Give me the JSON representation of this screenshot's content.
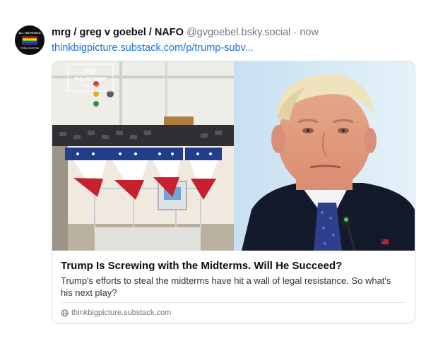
{
  "post": {
    "author": {
      "display_name": "mrg / greg v goebel / NAFO",
      "handle": "@gvgoebel.bsky.social",
      "avatar_text_top": "ALL THE PEOPLE",
      "avatar_text_bottom": "PRIDE EVERYONE"
    },
    "separator": "·",
    "time": "now",
    "link_text": "thinkbigpicture.substack.com/p/trump-subv..."
  },
  "card": {
    "image_logo_line1": "THE",
    "image_logo_line2": "BIG PICTURE",
    "image_logo_line3": "TEAM TAKES",
    "title": "Trump Is Screwing with the Midterms. Will He Succeed?",
    "description": "Trump's efforts to steal the midterms have hit a wall of legal resistance. So what's his next play?",
    "domain": "thinkbigpicture.substack.com",
    "domain_icon": "globe-icon"
  },
  "colors": {
    "link": "#1a73e8",
    "text_primary": "#0b0f14",
    "text_secondary": "#6f7780",
    "card_border": "#d7dce1"
  }
}
